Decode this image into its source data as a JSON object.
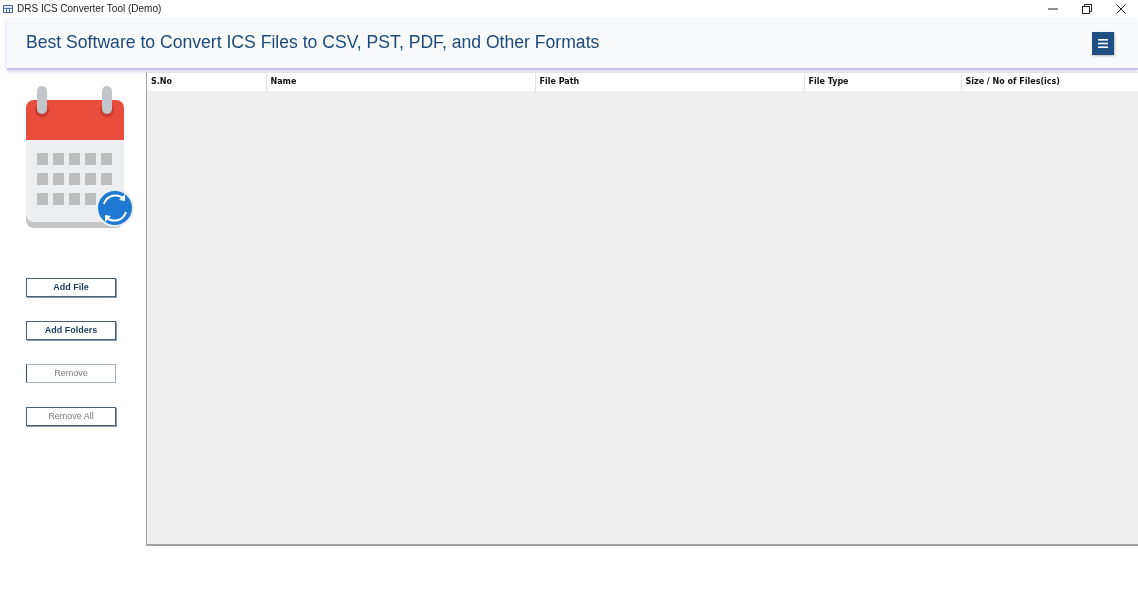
{
  "window": {
    "title": "DRS ICS Converter Tool (Demo)"
  },
  "header": {
    "title": "Best Software to Convert ICS Files to CSV, PST, PDF, and Other Formats"
  },
  "sidebar": {
    "buttons": [
      {
        "label": "Add File",
        "kind": "primary",
        "disabled": false
      },
      {
        "label": "Add Folders",
        "kind": "primary",
        "disabled": false
      },
      {
        "label": "Remove",
        "kind": "secondary",
        "disabled": true
      },
      {
        "label": "Remove All",
        "kind": "secondary",
        "disabled": false
      }
    ]
  },
  "table": {
    "columns": [
      "S.No",
      "Name",
      "File Path",
      "File Type",
      "Size / No of Files(ics)"
    ]
  }
}
